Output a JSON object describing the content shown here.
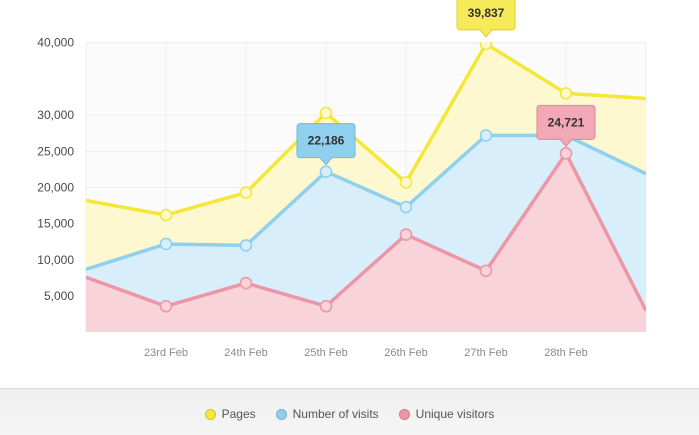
{
  "chart_data": {
    "type": "area",
    "x_categories": [
      "",
      "23rd Feb",
      "24th Feb",
      "25th Feb",
      "26th Feb",
      "27th Feb",
      "28th Feb",
      ""
    ],
    "y_ticks": [
      "5,000",
      "10,000",
      "15,000",
      "20,000",
      "25,000",
      "30,000",
      "40,000"
    ],
    "y_tick_values": [
      5000,
      10000,
      15000,
      20000,
      25000,
      30000,
      40000
    ],
    "grid": true,
    "legend_position": "bottom-center",
    "series": [
      {
        "name": "Pages",
        "color": "#f5e63a",
        "fill": "#fdf8cf",
        "values": [
          18200,
          16200,
          19300,
          30300,
          20700,
          39837,
          33000,
          32300
        ]
      },
      {
        "name": "Number of visits",
        "color": "#8fd0ee",
        "fill": "#d8effb",
        "values": [
          8700,
          12200,
          12000,
          22186,
          17300,
          27200,
          27200,
          21900
        ]
      },
      {
        "name": "Unique visitors",
        "color": "#ec96a7",
        "fill": "#f9d3da",
        "values": [
          7600,
          3600,
          6800,
          3600,
          13500,
          8500,
          24721,
          3000
        ]
      }
    ],
    "tooltips": [
      {
        "label": "22,186",
        "series": 1,
        "index": 3,
        "color": "#8fd0ee",
        "border": "#6fb9dd"
      },
      {
        "label": "39,837",
        "series": 0,
        "index": 5,
        "color": "#f7ea5a",
        "border": "#e0cf30"
      },
      {
        "label": "24,721",
        "series": 2,
        "index": 6,
        "color": "#f2a9b7",
        "border": "#de8597"
      }
    ]
  },
  "legend": [
    {
      "label": "Pages",
      "color": "#f5e63a"
    },
    {
      "label": "Number of visits",
      "color": "#8fd0ee"
    },
    {
      "label": "Unique visitors",
      "color": "#ec96a7"
    }
  ]
}
